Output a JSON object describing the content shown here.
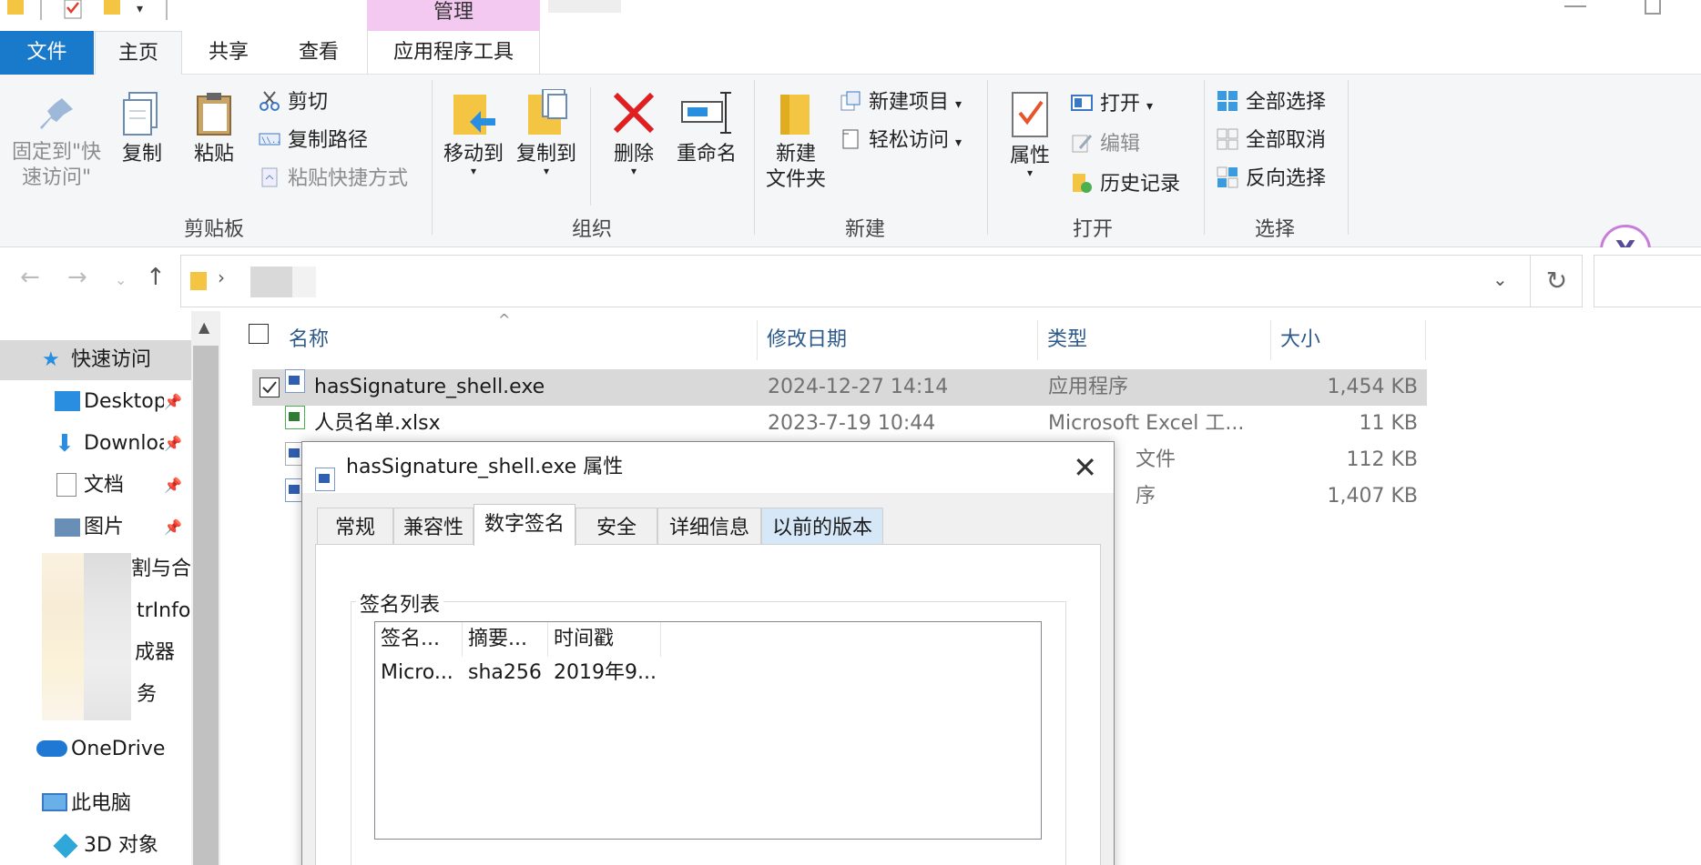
{
  "qat": {
    "manage_label": "管理"
  },
  "tabs": {
    "file": "文件",
    "home": "主页",
    "share": "共享",
    "view": "查看",
    "app_tools": "应用程序工具"
  },
  "ribbon": {
    "pin": "固定到\"快\n速访问\"",
    "pin_line1": "固定到\"快",
    "pin_line2": "速访问\"",
    "copy": "复制",
    "paste": "粘贴",
    "cut": "剪切",
    "copy_path": "复制路径",
    "paste_shortcut": "粘贴快捷方式",
    "clipboard_group": "剪贴板",
    "move_to": "移动到",
    "copy_to": "复制到",
    "delete": "删除",
    "rename": "重命名",
    "organize_group": "组织",
    "new_folder_line1": "新建",
    "new_folder_line2": "文件夹",
    "new_item": "新建项目",
    "easy_access": "轻松访问",
    "new_group": "新建",
    "properties": "属性",
    "open": "打开",
    "edit": "编辑",
    "history": "历史记录",
    "open_group": "打开",
    "select_all": "全部选择",
    "select_none": "全部取消",
    "invert_selection": "反向选择",
    "select_group": "选择",
    "colors": {
      "accent": "#1979ca",
      "manage": "#f3c8f1"
    }
  },
  "nav": {
    "quick_access": "快速访问",
    "desktop": "Desktop",
    "downloads": "Downloa",
    "documents": "文档",
    "pictures": "图片",
    "blur1": "割与合",
    "blur2": "trInfo",
    "blur3": "成器",
    "blur4": "务",
    "onedrive": "OneDrive",
    "this_pc": "此电脑",
    "objects_3d": "3D 对象"
  },
  "columns": {
    "name": "名称",
    "modified": "修改日期",
    "type": "类型",
    "size": "大小"
  },
  "files": [
    {
      "name": "hasSignature_shell.exe",
      "modified": "2024-12-27 14:14",
      "type": "应用程序",
      "size": "1,454 KB"
    },
    {
      "name": "人员名单.xlsx",
      "modified": "2023-7-19 10:44",
      "type": "Microsoft Excel 工...",
      "size": "11 KB"
    },
    {
      "name": "",
      "modified": "",
      "type": "文件",
      "size": "112 KB"
    },
    {
      "name": "",
      "modified": "",
      "type": "序",
      "size": "1,407 KB"
    }
  ],
  "dialog": {
    "title": "hasSignature_shell.exe 属性",
    "tabs": [
      "常规",
      "兼容性",
      "数字签名",
      "安全",
      "详细信息",
      "以前的版本"
    ],
    "signature_list_label": "签名列表",
    "list_headers": [
      "签名...",
      "摘要...",
      "时间戳"
    ],
    "rows": [
      {
        "signer": "Micro...",
        "digest": "sha256",
        "timestamp": "2019年9..."
      }
    ]
  }
}
